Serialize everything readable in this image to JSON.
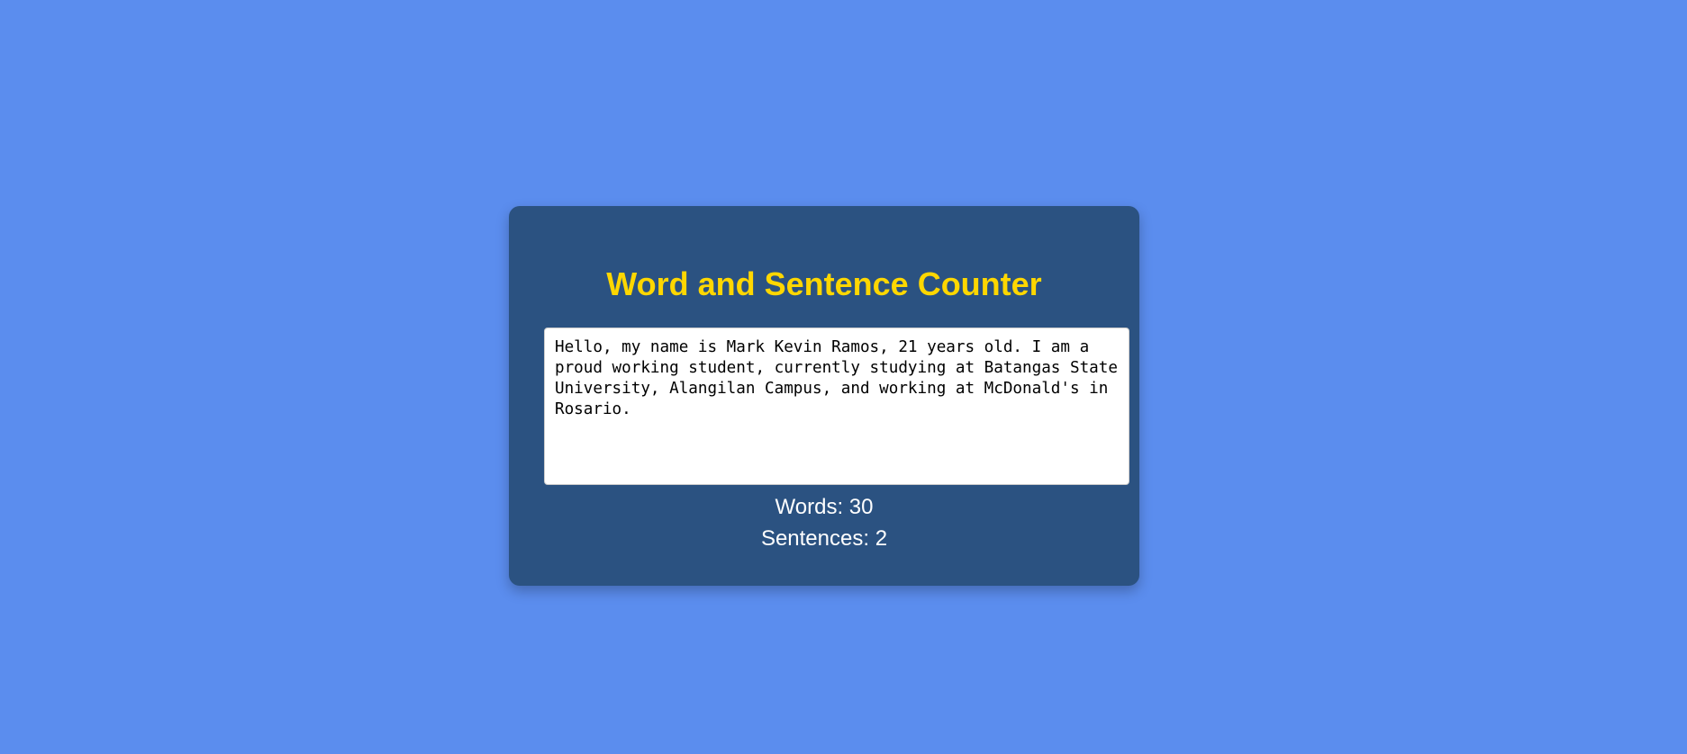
{
  "app": {
    "title": "Word and Sentence Counter"
  },
  "editor": {
    "value": "Hello, my name is Mark Kevin Ramos, 21 years old. I am a proud working student, currently studying at Batangas State University, Alangilan Campus, and working at McDonald's in Rosario."
  },
  "stats": {
    "words_text": "Words: 30",
    "sentences_text": "Sentences: 2",
    "words": 30,
    "sentences": 2
  },
  "colors": {
    "background": "#5b8dee",
    "card": "#2b5281",
    "title": "#ffd700",
    "stat_text": "#ffffff"
  }
}
